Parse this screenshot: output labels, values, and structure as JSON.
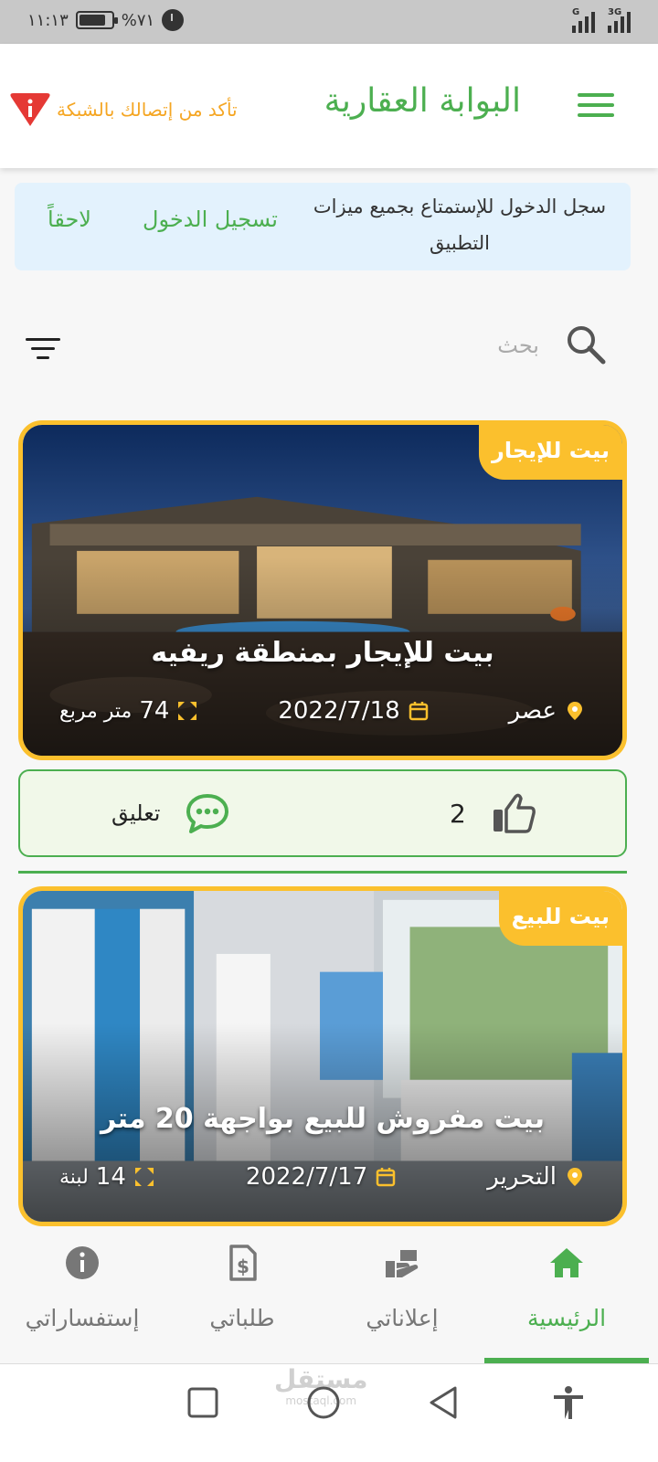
{
  "status_bar": {
    "time": "١١:١٣",
    "battery": "%٧١",
    "network_1": "G",
    "network_2": "3G"
  },
  "header": {
    "title": "البوابة العقارية",
    "network_warning": "تأكد من إتصالك بالشبكة"
  },
  "login_banner": {
    "message": "سجل الدخول للإستمتاع بجميع ميزات التطبيق",
    "login_label": "تسجيل الدخول",
    "later_label": "لاحقاً"
  },
  "search": {
    "placeholder": "بحث"
  },
  "listings": [
    {
      "tag": "بيت للإيجار",
      "title": "بيت للإيجار بمنطقة ريفيه",
      "location": "عصر",
      "date": "2022/7/18",
      "area_value": "74",
      "area_unit": "متر مربع"
    },
    {
      "tag": "بيت للبيع",
      "title": "بيت مفروش للبيع بواجهة 20 متر",
      "location": "التحرير",
      "date": "2022/7/17",
      "area_value": "14",
      "area_unit": "لبنة"
    }
  ],
  "actions": {
    "likes": "2",
    "comment_label": "تعليق"
  },
  "bottom_nav": {
    "items": [
      {
        "label": "الرئيسية",
        "icon": "home-icon"
      },
      {
        "label": "إعلاناتي",
        "icon": "ads-icon"
      },
      {
        "label": "طلباتي",
        "icon": "requests-icon"
      },
      {
        "label": "إستفساراتي",
        "icon": "info-icon"
      }
    ]
  },
  "watermark": {
    "text": "مستقل",
    "sub": "mostaql.com"
  },
  "colors": {
    "accent": "#4caf50",
    "tag": "#fbc02d",
    "warning": "#f5a623",
    "banner": "#e3f2fd"
  }
}
